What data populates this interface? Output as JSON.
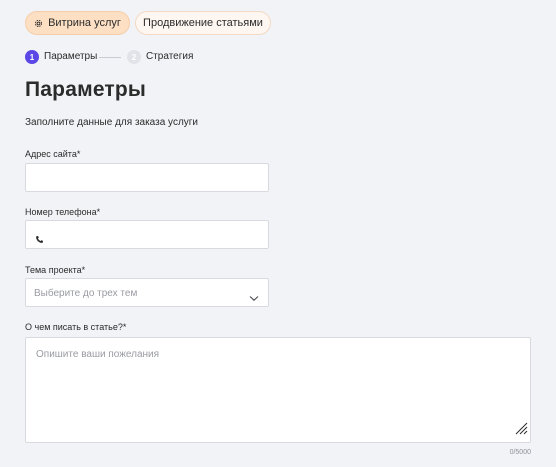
{
  "tabs": [
    {
      "label": "Витрина услуг",
      "icon": "gear-icon"
    },
    {
      "label": "Продвижение статьями"
    }
  ],
  "stepper": [
    {
      "number": "1",
      "label": "Параметры",
      "active": true
    },
    {
      "number": "2",
      "label": "Стратегия",
      "active": false
    }
  ],
  "heading": "Параметры",
  "subtitle": "Заполните данные для заказа услуги",
  "form": {
    "site_label": "Адрес сайта*",
    "site_value": "",
    "phone_label": "Номер телефона*",
    "phone_value": "",
    "phone_icon": "phone-icon",
    "topic_label": "Тема проекта*",
    "topic_placeholder": "Выберите до трех тем",
    "wishes_label": "О чем писать в статье?*",
    "wishes_placeholder": "Опишите ваши пожелания",
    "wishes_counter": "0/5000"
  },
  "colors": {
    "accent": "#5b47e5",
    "active_tab_bg": "#fde0c4",
    "background": "#f2f3f7"
  }
}
